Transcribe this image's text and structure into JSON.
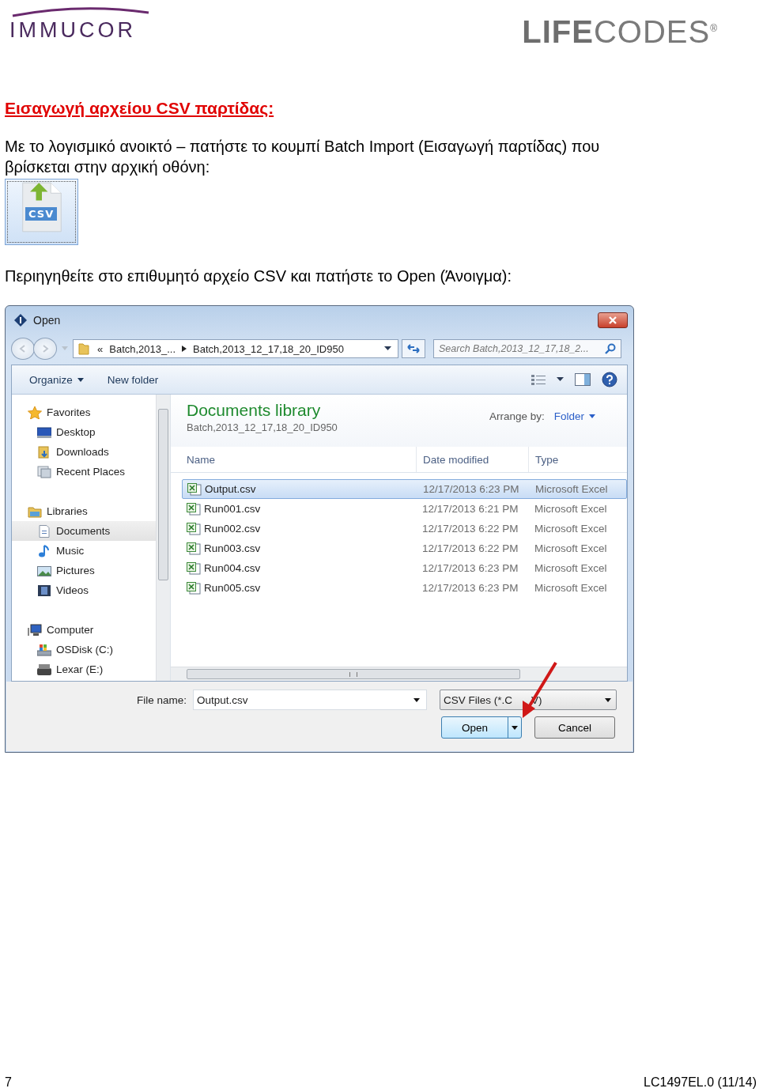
{
  "header": {
    "left_logo": "IMMUCOR",
    "right_logo": {
      "bold": "LIFE",
      "light": "CODES",
      "mark": "®"
    }
  },
  "heading": "Εισαγωγή αρχείου CSV παρτίδας:",
  "paragraph_1": "Με το λογισμικό ανοικτό – πατήστε το κουμπί Batch Import (Εισαγωγή παρτίδας) που βρίσκεται στην αρχική οθόνη:",
  "batch_import_button": {
    "label": "CSV"
  },
  "paragraph_2": "Περιηγηθείτε στο επιθυμητό αρχείο CSV και πατήστε το Open (Άνοιγμα):",
  "dialog": {
    "title": "Open",
    "breadcrumb": [
      "«",
      "Batch,2013_...",
      "Batch,2013_12_17,18_20_ID950"
    ],
    "search": {
      "placeholder": "Search Batch,2013_12_17,18_2..."
    },
    "toolbar": [
      "Organize",
      "New folder"
    ],
    "nav": [
      {
        "label": "Favorites",
        "kind": "star",
        "selected": false,
        "children": [
          {
            "label": "Desktop",
            "kind": "desktop",
            "selected": false
          },
          {
            "label": "Downloads",
            "kind": "downloads",
            "selected": false
          },
          {
            "label": "Recent Places",
            "kind": "recent",
            "selected": false
          }
        ]
      },
      {
        "label": "Libraries",
        "kind": "library",
        "selected": false,
        "children": [
          {
            "label": "Documents",
            "kind": "document",
            "selected": true
          },
          {
            "label": "Music",
            "kind": "music",
            "selected": false
          },
          {
            "label": "Pictures",
            "kind": "pictures",
            "selected": false
          },
          {
            "label": "Videos",
            "kind": "videos",
            "selected": false
          }
        ]
      },
      {
        "label": "Computer",
        "kind": "computer",
        "selected": false,
        "children": [
          {
            "label": "OSDisk (C:)",
            "kind": "disk",
            "selected": false
          },
          {
            "label": "Lexar (E:)",
            "kind": "drive",
            "selected": false
          }
        ]
      }
    ],
    "library": {
      "title": "Documents library",
      "subtitle": "Batch,2013_12_17,18_20_ID950",
      "arrange_label": "Arrange by:",
      "arrange_value": "Folder"
    },
    "columns": [
      "Name",
      "Date modified",
      "Type"
    ],
    "files": [
      {
        "name": "Output.csv",
        "date": "12/17/2013 6:23 PM",
        "type": "Microsoft Excel",
        "selected": true
      },
      {
        "name": "Run001.csv",
        "date": "12/17/2013 6:21 PM",
        "type": "Microsoft Excel",
        "selected": false
      },
      {
        "name": "Run002.csv",
        "date": "12/17/2013 6:22 PM",
        "type": "Microsoft Excel",
        "selected": false
      },
      {
        "name": "Run003.csv",
        "date": "12/17/2013 6:22 PM",
        "type": "Microsoft Excel",
        "selected": false
      },
      {
        "name": "Run004.csv",
        "date": "12/17/2013 6:23 PM",
        "type": "Microsoft Excel",
        "selected": false
      },
      {
        "name": "Run005.csv",
        "date": "12/17/2013 6:23 PM",
        "type": "Microsoft Excel",
        "selected": false
      }
    ],
    "file_name_label": "File name:",
    "file_name": "Output.csv",
    "filter": [
      "CSV Files (*.C",
      "V)"
    ],
    "buttons": [
      "Open",
      "Cancel"
    ]
  },
  "footer": {
    "page": "7",
    "code": "LC1497EL.0 (11/14)"
  }
}
